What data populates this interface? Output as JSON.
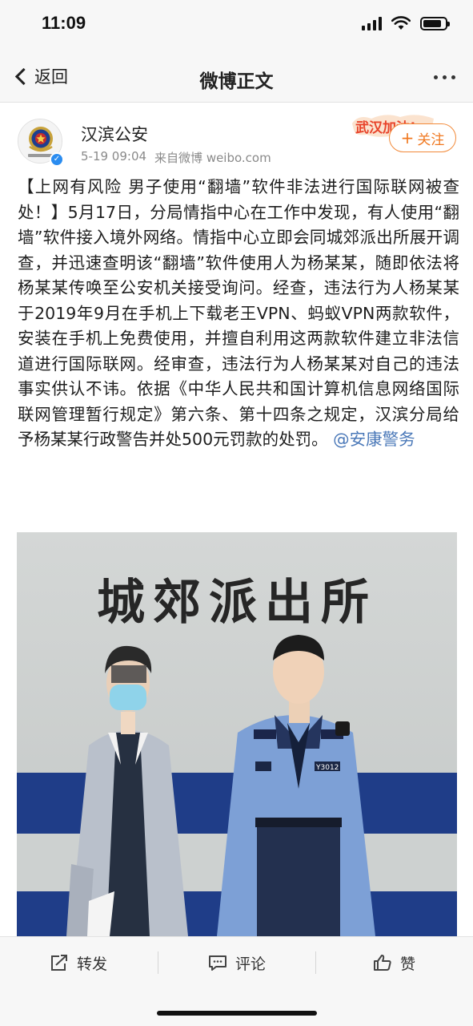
{
  "status_bar": {
    "time": "11:09",
    "icons": [
      "signal-icon",
      "wifi-icon",
      "battery-icon"
    ],
    "battery_level": 0.85
  },
  "nav": {
    "back_label": "返回",
    "title": "微博正文",
    "more_icon": "more-dots-icon"
  },
  "post": {
    "author": "汉滨公安",
    "verified": true,
    "time": "5-19 09:04",
    "source": "来自微博 weibo.com",
    "follow_label": "关注",
    "banner_text": "武汉加油!",
    "body": "【上网有风险 男子使用“翻墙”软件非法进行国际联网被查处！】5月17日，分局情指中心在工作中发现，有人使用“翻墙”软件接入境外网络。情指中心立即会同城郊派出所展开调查，并迅速查明该“翻墙”软件使用人为杨某某，随即依法将杨某某传唤至公安机关接受询问。经查，违法行为人杨某某于2019年9月在手机上下载老王VPN、蚂蚁VPN两款软件，安装在手机上免费使用，并擅自利用这两款软件建立非法信道进行国际联网。经审查，违法行为人杨某某对自己的违法事实供认不讳。依据《中华人民共和国计算机信息网络国际联网管理暂行规定》第六条、第十四条之规定，汉滨分局给予杨某某行政警告并处500元罚款的处罚。",
    "mention": "@安康警务",
    "photo_sign": "城郊派出所",
    "badge_text": "Y3012"
  },
  "toolbar": {
    "repost_label": "转发",
    "comment_label": "评论",
    "like_label": "赞"
  }
}
